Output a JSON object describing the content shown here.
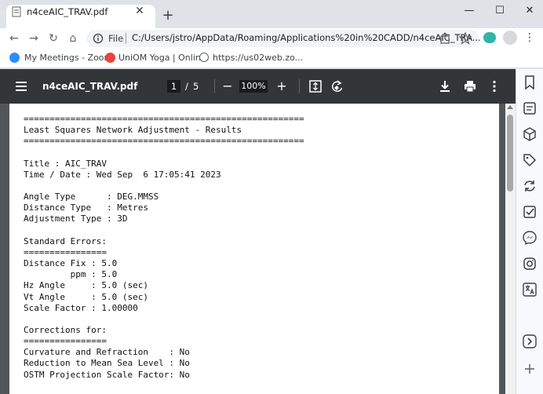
{
  "tab": {
    "title": "n4ceAIC_TRAV.pdf",
    "close": "✕",
    "new_tab": "+"
  },
  "window_controls": {
    "minimize": "—",
    "maximize": "☐",
    "close": "✕"
  },
  "toolbar": {
    "back": "←",
    "forward": "→",
    "reload": "↻",
    "home": "⌂",
    "file_label": "File",
    "url": "C:/Users/jstro/AppData/Roaming/Applications%20in%20CADD/n4ceAIC_TRA...",
    "menu": "⋮"
  },
  "bookmarks": [
    {
      "label": "My Meetings - Zoom",
      "icon": "zoom-icon",
      "color": "#2d8cff"
    },
    {
      "label": "UniOM Yoga | Onlin...",
      "icon": "yoga-icon",
      "color": "#e8453c"
    },
    {
      "label": "https://us02web.zo...",
      "icon": "globe-icon",
      "color": "#5f6368"
    }
  ],
  "pdf": {
    "title": "n4ceAIC_TRAV.pdf",
    "page_current": "1",
    "page_separator": "/",
    "page_total": "5",
    "zoom": "100%",
    "zoom_out": "−",
    "zoom_in": "+"
  },
  "document": {
    "text": "======================================================\nLeast Squares Network Adjustment - Results\n======================================================\n\nTitle : AIC_TRAV\nTime / Date : Wed Sep  6 17:05:41 2023\n\nAngle Type      : DEG.MMSS\nDistance Type   : Metres\nAdjustment Type : 3D\n\nStandard Errors:\n================\nDistance Fix : 5.0\n         ppm : 5.0\nHz Angle     : 5.0 (sec)\nVt Angle     : 5.0 (sec)\nScale Factor : 1.00000\n\nCorrections for:\n================\nCurvature and Refraction    : No\nReduction to Mean Sea Level : No\nOSTM Projection Scale Factor: No"
  },
  "side_panel": {
    "icons": [
      "bookmark-icon",
      "notes-icon",
      "cube-icon",
      "tag-icon",
      "sync-icon",
      "tasks-icon",
      "messenger-icon",
      "instagram-icon",
      "translate-icon",
      "reader-icon",
      "add-icon"
    ]
  },
  "colors": {
    "chrome_bg": "#dfe3e8",
    "pdf_header": "#323639",
    "pdf_bg": "#525659",
    "extension": "#2fb5a7"
  }
}
